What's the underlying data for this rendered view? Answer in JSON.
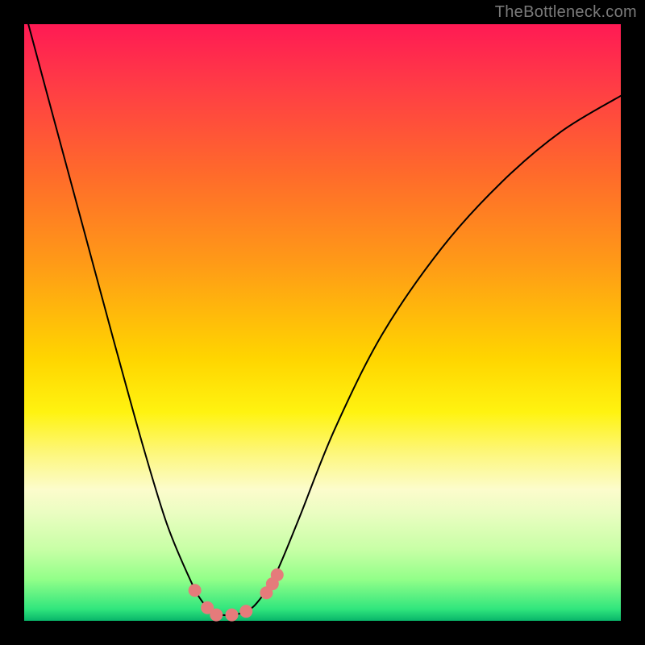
{
  "watermark": "TheBottleneck.com",
  "chart_data": {
    "type": "line",
    "title": "",
    "xlabel": "",
    "ylabel": "",
    "xlim": [
      0,
      1
    ],
    "ylim": [
      0,
      1
    ],
    "curve": {
      "name": "bottleneck-curve",
      "color": "#000000",
      "width": 2,
      "x": [
        0.007,
        0.05,
        0.1,
        0.15,
        0.2,
        0.24,
        0.28,
        0.3,
        0.315,
        0.33,
        0.35,
        0.37,
        0.39,
        0.42,
        0.46,
        0.52,
        0.6,
        0.7,
        0.8,
        0.9,
        1.0
      ],
      "y": [
        1.0,
        0.84,
        0.655,
        0.47,
        0.29,
        0.16,
        0.065,
        0.03,
        0.015,
        0.01,
        0.01,
        0.015,
        0.03,
        0.075,
        0.17,
        0.32,
        0.48,
        0.625,
        0.735,
        0.82,
        0.88
      ]
    },
    "markers": {
      "name": "highlight-dots",
      "color": "#e57b7b",
      "radius": 8,
      "x": [
        0.286,
        0.307,
        0.322,
        0.348,
        0.372,
        0.406,
        0.416,
        0.424
      ],
      "y": [
        0.051,
        0.022,
        0.01,
        0.01,
        0.016,
        0.047,
        0.062,
        0.077
      ]
    },
    "gradient_zones": [
      {
        "position": 0.0,
        "label": "high-bottleneck",
        "color": "#ff1a54"
      },
      {
        "position": 0.5,
        "label": "moderate",
        "color": "#ffd500"
      },
      {
        "position": 0.98,
        "label": "optimal",
        "color": "#08b56a"
      }
    ]
  }
}
